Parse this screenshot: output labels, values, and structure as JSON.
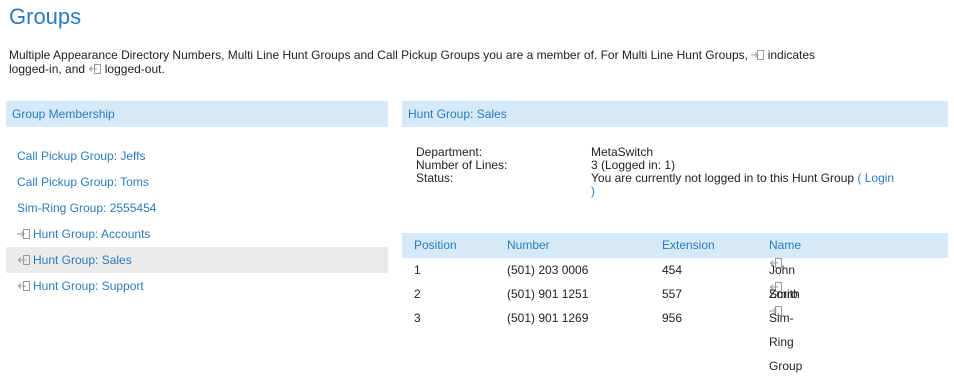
{
  "page": {
    "title": "Groups",
    "intro_part1": "Multiple Appearance Directory Numbers, Multi Line Hunt Groups and Call Pickup Groups you are a member of. For Multi Line Hunt Groups,",
    "intro_part2": "indicates",
    "intro_part3": "logged-in, and",
    "intro_part4": "logged-out."
  },
  "left_panel": {
    "header": "Group Membership",
    "items": [
      {
        "label": "Call Pickup Group: Jeffs",
        "icon": ""
      },
      {
        "label": "Call Pickup Group: Toms",
        "icon": ""
      },
      {
        "label": "Sim-Ring Group: 2555454",
        "icon": ""
      },
      {
        "label": "Hunt Group: Accounts",
        "icon": "logged-in-icon"
      },
      {
        "label": "Hunt Group: Sales",
        "icon": "logged-out-icon"
      },
      {
        "label": "Hunt Group: Support",
        "icon": "logged-out-icon"
      }
    ]
  },
  "right_panel": {
    "header": "Hunt Group: Sales",
    "department_label": "Department:",
    "department_value": "MetaSwitch",
    "lines_label": "Number of Lines:",
    "lines_value": "3  (Logged in: 1)",
    "status_label": "Status:",
    "status_value": "You are currently not logged in to this Hunt Group",
    "login_link_line1": "( Login",
    "login_link_line2": ")"
  },
  "table": {
    "headers": [
      "Position",
      "Number",
      "Extension",
      "Name"
    ],
    "rows": [
      {
        "position": "1",
        "number": "(501) 203 0006",
        "extension": "454",
        "name": "John Smith",
        "icon": "logged-out-icon"
      },
      {
        "position": "2",
        "number": "(501) 901 1251",
        "extension": "557",
        "name": "Zorro",
        "icon": "logged-out-icon"
      },
      {
        "position": "3",
        "number": "(501) 901 1269",
        "extension": "956",
        "name": "Sim-Ring Group",
        "icon": "logged-in-icon"
      }
    ]
  },
  "colors": {
    "accent": "#2b7bc1",
    "header_bg": "#d6e9f8",
    "selected_bg": "#ebebeb"
  }
}
